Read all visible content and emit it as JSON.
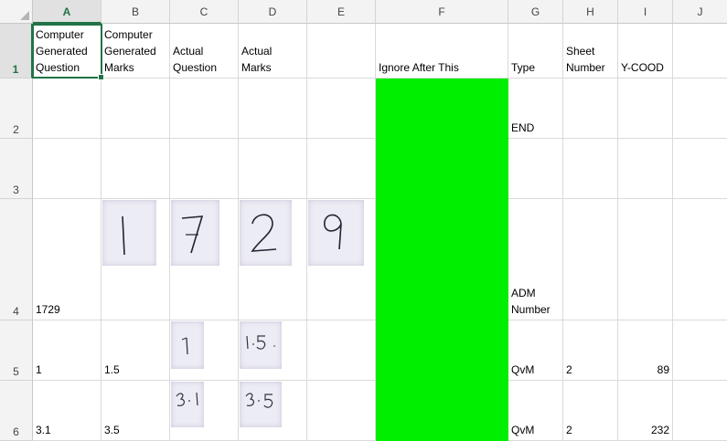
{
  "columns": [
    "A",
    "B",
    "C",
    "D",
    "E",
    "F",
    "G",
    "H",
    "I",
    "J"
  ],
  "rows": [
    "1",
    "2",
    "3",
    "4",
    "5",
    "6"
  ],
  "cells": {
    "A1": "Computer\nGenerated\nQuestion",
    "B1": "Computer\nGenerated\nMarks",
    "C1": "Actual\nQuestion",
    "D1": "Actual\nMarks",
    "F1": "Ignore After This",
    "G1": "Type",
    "H1": "Sheet\nNumber",
    "I1": "Y-COOD",
    "G2": "END",
    "A4": "1729",
    "G4": "ADM\nNumber",
    "A5": "1",
    "B5": "1.5",
    "G5": "QvM",
    "H5": "2",
    "I5": "89",
    "A6": "3.1",
    "B6": "3.5",
    "G6": "QvM",
    "H6": "2",
    "I6": "232"
  },
  "handwriting": {
    "B4": "1",
    "C4": "7",
    "D4": "2",
    "E4": "9",
    "C5": "1",
    "D5": "1.5",
    "C6": "3.1",
    "D6": "3.5"
  },
  "colors": {
    "green_fill": "#00ee00",
    "excel_accent": "#217346"
  }
}
